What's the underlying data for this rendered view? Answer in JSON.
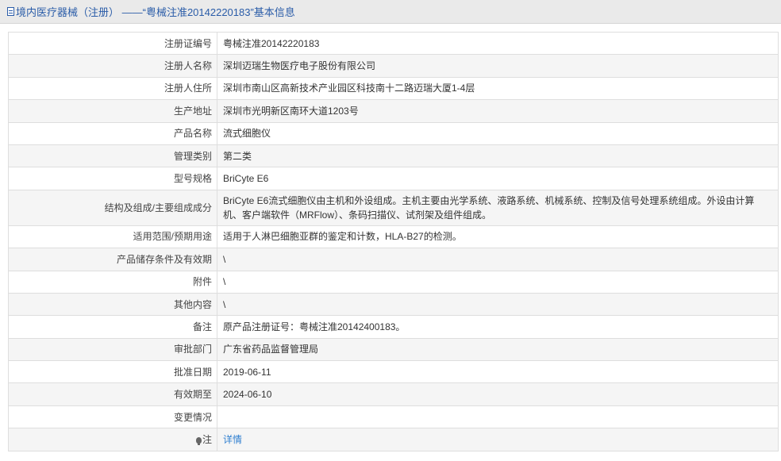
{
  "header": {
    "title": "境内医疗器械（注册） ——“粤械注准20142220183”基本信息"
  },
  "rows": [
    {
      "label": "注册证编号",
      "value": "粤械注准20142220183"
    },
    {
      "label": "注册人名称",
      "value": "深圳迈瑞生物医疗电子股份有限公司"
    },
    {
      "label": "注册人住所",
      "value": "深圳市南山区高新技术产业园区科技南十二路迈瑞大厦1-4层"
    },
    {
      "label": "生产地址",
      "value": "深圳市光明新区南环大道1203号"
    },
    {
      "label": "产品名称",
      "value": "流式细胞仪"
    },
    {
      "label": "管理类别",
      "value": "第二类"
    },
    {
      "label": "型号规格",
      "value": "BriCyte E6"
    },
    {
      "label": "结构及组成/主要组成成分",
      "value": "BriCyte E6流式细胞仪由主机和外设组成。主机主要由光学系统、液路系统、机械系统、控制及信号处理系统组成。外设由计算机、客户端软件（MRFlow）、条码扫描仪、试剂架及组件组成。"
    },
    {
      "label": "适用范围/预期用途",
      "value": "适用于人淋巴细胞亚群的鉴定和计数，HLA-B27的检测。"
    },
    {
      "label": "产品储存条件及有效期",
      "value": "\\"
    },
    {
      "label": "附件",
      "value": "\\"
    },
    {
      "label": "其他内容",
      "value": "\\"
    },
    {
      "label": "备注",
      "value": "原产品注册证号：粤械注准20142400183。"
    },
    {
      "label": "审批部门",
      "value": "广东省药品监督管理局"
    },
    {
      "label": "批准日期",
      "value": "2019-06-11"
    },
    {
      "label": "有效期至",
      "value": "2024-06-10"
    },
    {
      "label": "变更情况",
      "value": ""
    }
  ],
  "note_row": {
    "label": "注",
    "icon": "lightbulb-icon",
    "link_text": "详情"
  }
}
